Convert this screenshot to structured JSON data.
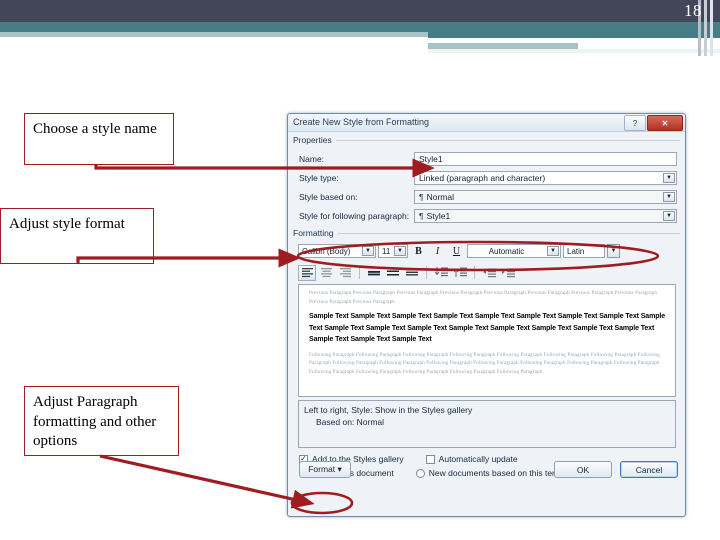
{
  "slide": {
    "page_number": "18",
    "accent_navy": "#434559",
    "accent_teal": "#457f85",
    "annotation_color": "#9f1c21"
  },
  "callouts": {
    "name": "Choose a style name",
    "format": "Adjust style format",
    "paragraph": "Adjust Paragraph formatting and other options"
  },
  "dialog": {
    "title": "Create New Style from Formatting",
    "titlebar": {
      "help_label": "?",
      "close_label": "✕"
    },
    "properties": {
      "group_label": "Properties",
      "rows": [
        {
          "label": "Name:",
          "value": "Style1",
          "type": "text"
        },
        {
          "label": "Style type:",
          "value": "Linked (paragraph and character)",
          "type": "combo"
        },
        {
          "label": "Style based on:",
          "value": "Normal",
          "type": "combo",
          "pilcrow": "¶"
        },
        {
          "label": "Style for following paragraph:",
          "value": "Style1",
          "type": "combo",
          "pilcrow": "¶"
        }
      ]
    },
    "formatting": {
      "group_label": "Formatting",
      "font_name": "Calibri (Body)",
      "font_size": "11",
      "bold_label": "B",
      "italic_label": "I",
      "underline_label": "U",
      "font_color": "Automatic",
      "script": "Latin",
      "arrow_glyph": "▼"
    },
    "preview": {
      "previous_paragraph": "Previous Paragraph Previous Paragraph Previous Paragraph Previous Paragraph Previous Paragraph Previous Paragraph Previous Paragraph Previous Paragraph Previous Paragraph Previous Paragraph",
      "sample_text": "Sample Text Sample Text Sample Text Sample Text Sample Text Sample Text Sample Text Sample Text Sample Text Sample Text Sample Text Sample Text Sample Text Sample Text Sample Text Sample Text Sample Text Sample Text Sample Text Sample Text",
      "following_paragraph": "Following Paragraph Following Paragraph Following Paragraph Following Paragraph Following Paragraph Following Paragraph Following Paragraph Following Paragraph Following Paragraph Following Paragraph Following Paragraph Following Paragraph Following Paragraph Following Paragraph Following Paragraph Following Paragraph Following Paragraph Following Paragraph Following Paragraph Following Paragraph"
    },
    "description": {
      "line1": "Left to right, Style: Show in the Styles gallery",
      "line2": "Based on: Normal"
    },
    "options": {
      "add_to_gallery": {
        "label": "Add to the Styles gallery",
        "checked": true,
        "check_glyph": "✓"
      },
      "auto_update": {
        "label": "Automatically update",
        "checked": false,
        "check_glyph": ""
      },
      "only_this_document": {
        "label": "Only in this document",
        "selected": true
      },
      "new_documents": {
        "label": "New documents based on this template",
        "selected": false
      }
    },
    "buttons": {
      "format": "Format ▾",
      "ok": "OK",
      "cancel": "Cancel"
    }
  }
}
